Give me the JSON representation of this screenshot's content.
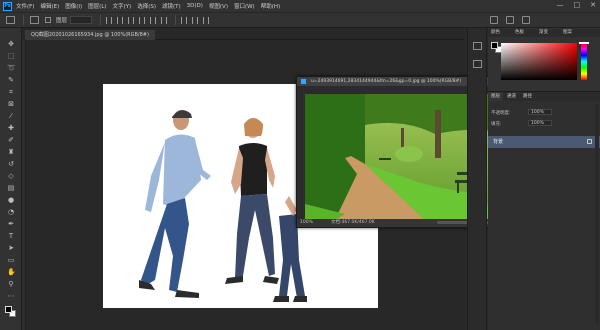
{
  "app": {
    "logo": "Ps"
  },
  "menubar": {
    "items": [
      "文件(F)",
      "编辑(E)",
      "图像(I)",
      "图层(L)",
      "文字(Y)",
      "选择(S)",
      "滤镜(T)",
      "3D(D)",
      "视图(V)",
      "窗口(W)",
      "帮助(H)"
    ],
    "window_controls": {
      "minimize": "—",
      "maximize": "□",
      "close": "✕"
    }
  },
  "options_bar": {
    "auto_select_label": "图层"
  },
  "document_tabs": [
    {
      "label": "QQ截图20201026165934.jpg @ 100%(RGB/8#)"
    }
  ],
  "floating_document": {
    "title": "u=2493914691,2834144944&fm=26&gp=0.jpg @ 100%(RGB/8#)",
    "close": "✕",
    "zoom": "100%",
    "doc_info": "文档:467.0K/467.0K"
  },
  "panels": {
    "color_tabs": [
      "颜色",
      "色板",
      "渐变",
      "图案"
    ],
    "layers_tabs": [
      "图层",
      "通道",
      "路径"
    ],
    "opacity_label": "不透明度:",
    "opacity_value": "100%",
    "fill_label": "填充:",
    "fill_value": "100%",
    "layer_name": "背景"
  },
  "colors": {
    "accent": "#31a8ff",
    "selected_layer": "#4b5a73",
    "foreground": "#000000",
    "background": "#ffffff"
  },
  "tools": [
    "move-tool",
    "marquee-tool",
    "lasso-tool",
    "quick-select-tool",
    "crop-tool",
    "frame-tool",
    "eyedropper-tool",
    "healing-brush-tool",
    "brush-tool",
    "clone-stamp-tool",
    "history-brush-tool",
    "eraser-tool",
    "gradient-tool",
    "blur-tool",
    "dodge-tool",
    "pen-tool",
    "type-tool",
    "path-select-tool",
    "rectangle-tool",
    "hand-tool",
    "zoom-tool",
    "more-tools"
  ]
}
